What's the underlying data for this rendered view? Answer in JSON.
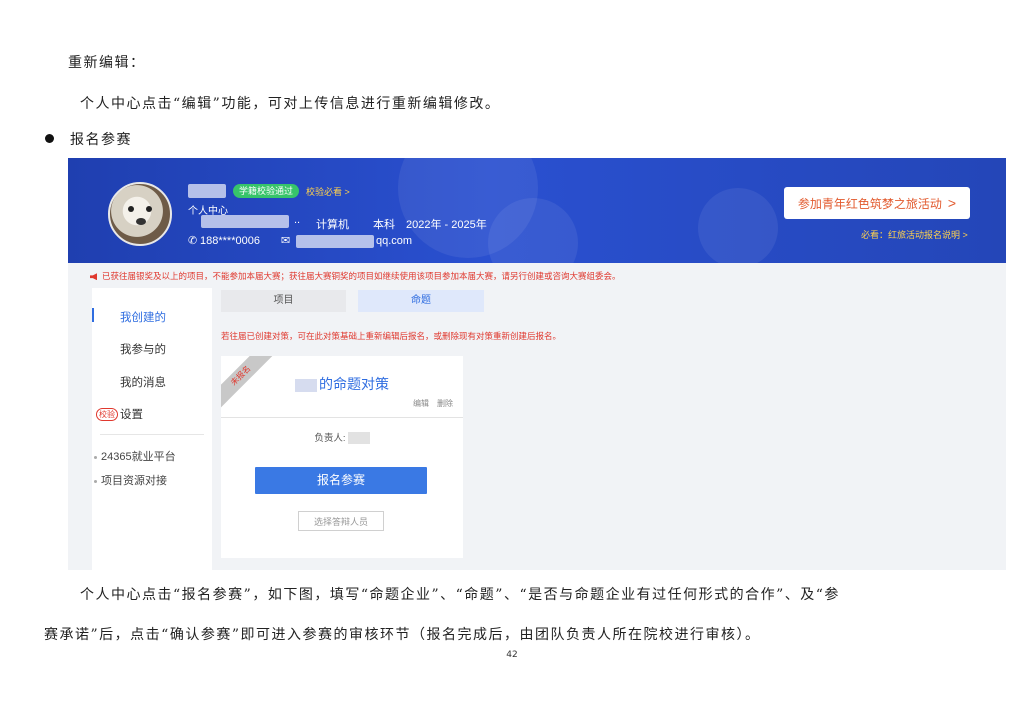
{
  "document": {
    "heading_edit": "重新编辑：",
    "para_edit": "个人中心点击“编辑”功能，可对上传信息进行重新编辑修改。",
    "bullet_label": "报名参赛",
    "para_signup_line1": "个人中心点击“报名参赛”，如下图，填写“命题企业”、“命题”、“是否与命题企业有过任何形式的合作”、及“参",
    "para_signup_line2": "赛承诺”后，点击“确认参赛”即可进入参赛的审核环节（报名完成后，由团队负责人所在院校进行审核）。",
    "page_number": "42"
  },
  "screenshot": {
    "banner": {
      "badge": "学籍校验通过",
      "verify_link": "校验必看 >",
      "title": "个人中心",
      "ellipsis": "..",
      "major": "计算机",
      "degree": "本科",
      "years": "2022年 - 2025年",
      "phone": "188****0006",
      "email_suffix": "qq.com",
      "join_button": "参加青年红色筑梦之旅活动",
      "join_button_arrow": ">",
      "must_read": "必看：红旅活动报名说明 >"
    },
    "notice": "已获往届银奖及以上的项目，不能参加本届大赛；获往届大赛铜奖的项目如继续使用该项目参加本届大赛，请另行创建或咨询大赛组委会。",
    "sidebar": {
      "items": [
        {
          "label": "我创建的"
        },
        {
          "label": "我参与的"
        },
        {
          "label": "我的消息"
        },
        {
          "badge": "校验",
          "label": "设置"
        }
      ],
      "links": [
        {
          "label": "24365就业平台"
        },
        {
          "label": "项目资源对接"
        }
      ]
    },
    "tabs": {
      "project": "项目",
      "topic": "命题"
    },
    "hint": "若往届已创建对策，可在此对策基础上重新编辑后报名，或删除现有对策重新创建后报名。",
    "card": {
      "ribbon": "未报名",
      "title": "的命题对策",
      "edit": "编辑",
      "delete": "删除",
      "leader_label": "负责人:",
      "signup_button": "报名参赛",
      "select_button": "选择答辩人员"
    },
    "colors": {
      "banner_blue": "#2446b8",
      "accent_blue": "#3a79e4",
      "alert_red": "#e0382e",
      "badge_green": "#37c46a"
    }
  }
}
